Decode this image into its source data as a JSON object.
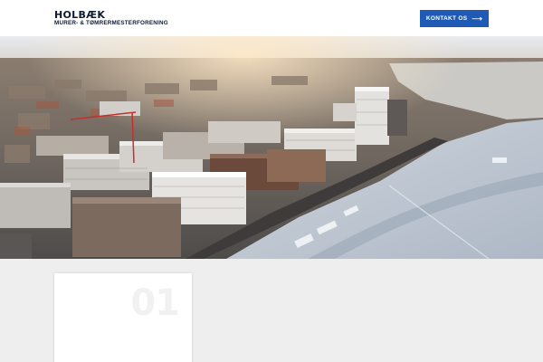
{
  "header": {
    "logo_title": "HOLBÆK",
    "logo_subtitle": "MURER- & TØMRERMESTERFORENING",
    "cta_label": "KONTAKT OS",
    "cta_icon": "arrow-right-icon",
    "cta_color": "#1f5ab4"
  },
  "section": {
    "cards": [
      {
        "number": "01"
      }
    ]
  }
}
